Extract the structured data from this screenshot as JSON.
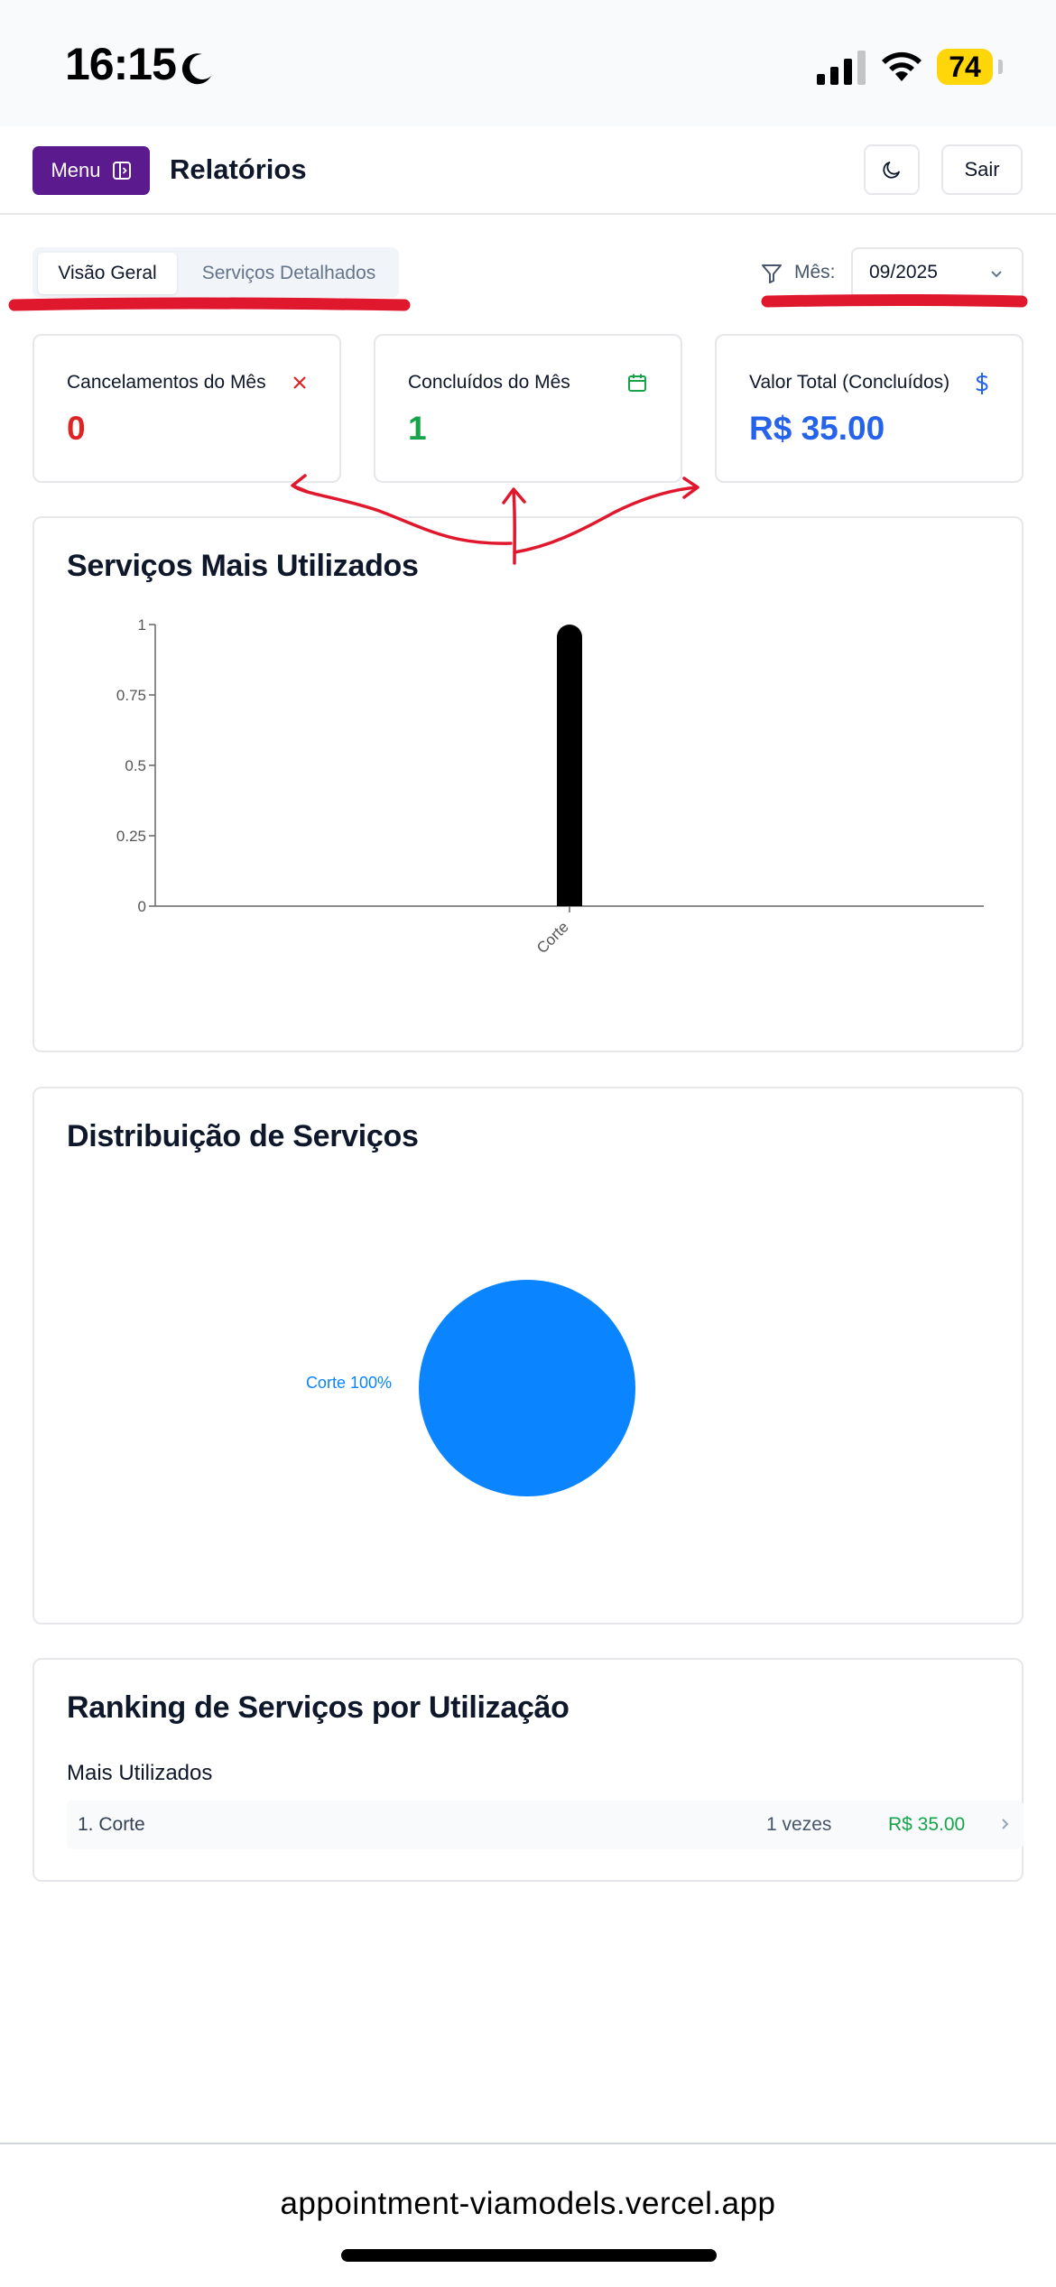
{
  "status_bar": {
    "time": "16:15",
    "battery": "74"
  },
  "header": {
    "menu_label": "Menu",
    "title": "Relatórios",
    "logout_label": "Sair"
  },
  "tabs": [
    {
      "label": "Visão Geral",
      "active": true
    },
    {
      "label": "Serviços Detalhados",
      "active": false
    }
  ],
  "filter": {
    "label": "Mês:",
    "value": "09/2025"
  },
  "stats": [
    {
      "label": "Cancelamentos do Mês",
      "value": "0",
      "color": "#dc2626",
      "icon": "x-icon"
    },
    {
      "label": "Concluídos do Mês",
      "value": "1",
      "color": "#16a34a",
      "icon": "calendar-icon"
    },
    {
      "label": "Valor Total (Concluídos)",
      "value": "R$ 35.00",
      "color": "#2563eb",
      "icon": "dollar-icon"
    }
  ],
  "bar_card": {
    "title": "Serviços Mais Utilizados"
  },
  "pie_card": {
    "title": "Distribuição de Serviços"
  },
  "chart_data": [
    {
      "type": "bar",
      "title": "Serviços Mais Utilizados",
      "categories": [
        "Corte"
      ],
      "values": [
        1
      ],
      "ylim": [
        0,
        1
      ],
      "yticks": [
        "0",
        "0.25",
        "0.5",
        "0.75",
        "1"
      ],
      "bar_color": "#000000",
      "grid": false
    },
    {
      "type": "pie",
      "title": "Distribuição de Serviços",
      "categories": [
        "Corte"
      ],
      "values": [
        100
      ],
      "labels": [
        "Corte 100%"
      ],
      "colors": [
        "#0a84ff"
      ]
    }
  ],
  "ranking": {
    "title": "Ranking de Serviços por Utilização",
    "subtitle": "Mais Utilizados",
    "items": [
      {
        "name": "1. Corte",
        "count": "1 vezes",
        "value": "R$ 35.00"
      }
    ]
  },
  "browser": {
    "url": "appointment-viamodels.vercel.app"
  },
  "colors": {
    "menu_bg": "#5b1a8e",
    "annotation_red": "#e0182d",
    "pie_blue": "#0a84ff"
  }
}
